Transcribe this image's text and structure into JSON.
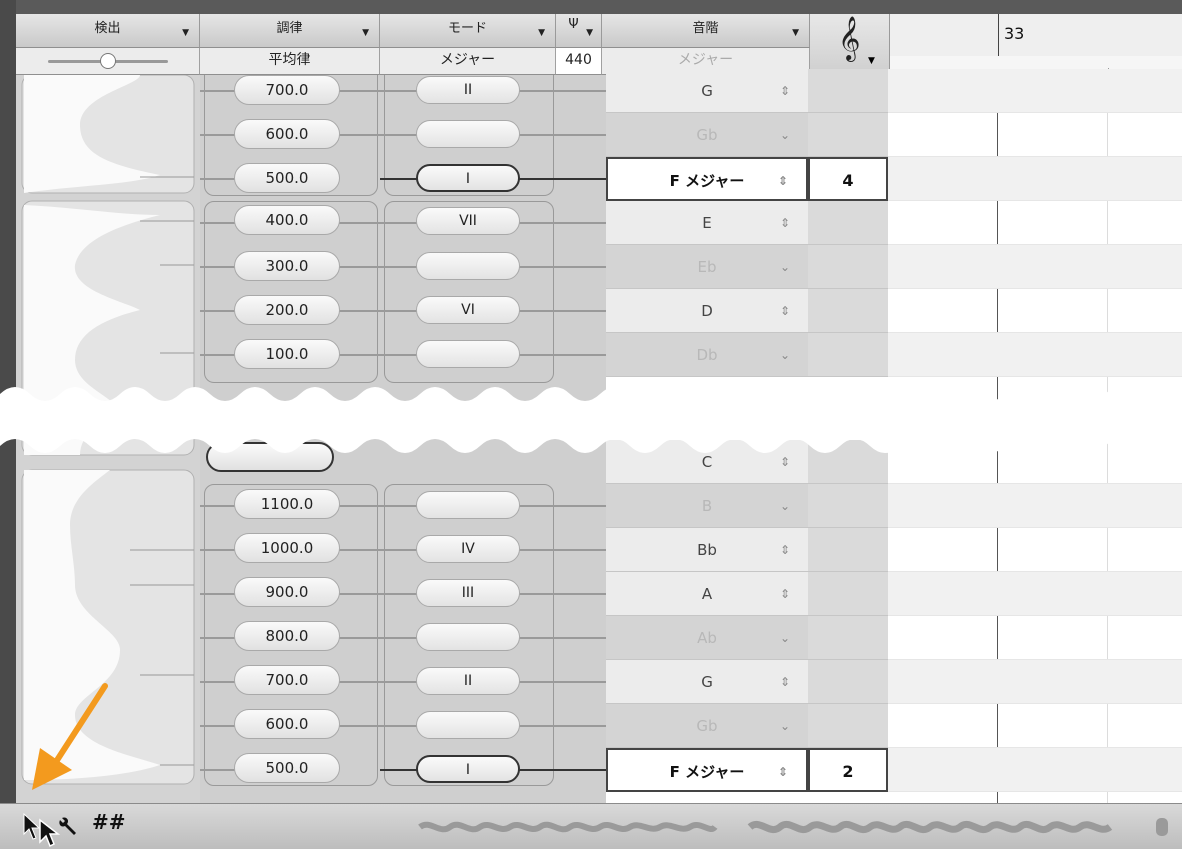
{
  "headers": {
    "detect": "検出",
    "tuning": "調律",
    "mode": "モード",
    "pitch_menu_glyph": "Ψ",
    "scale": "音階"
  },
  "subheaders": {
    "tuning_value": "平均律",
    "mode_value": "メジャー",
    "reference_pitch": "440",
    "scale_value": "メジャー"
  },
  "timeline": {
    "bar_number": "33"
  },
  "top_rows": [
    {
      "cents": "700.0",
      "mode": "II",
      "note": "G",
      "octave": "",
      "kind": "lite",
      "active_mode": true
    },
    {
      "cents": "600.0",
      "mode": "",
      "note": "Gb",
      "octave": "",
      "kind": "dim",
      "active_mode": false
    },
    {
      "cents": "500.0",
      "mode": "I",
      "note": "F メジャー",
      "octave": "4",
      "kind": "sel",
      "active_mode": true
    },
    {
      "cents": "400.0",
      "mode": "VII",
      "note": "E",
      "octave": "",
      "kind": "lite",
      "active_mode": true
    },
    {
      "cents": "300.0",
      "mode": "",
      "note": "Eb",
      "octave": "",
      "kind": "dim",
      "active_mode": false
    },
    {
      "cents": "200.0",
      "mode": "VI",
      "note": "D",
      "octave": "",
      "kind": "lite",
      "active_mode": true
    },
    {
      "cents": "100.0",
      "mode": "",
      "note": "Db",
      "octave": "",
      "kind": "dim",
      "active_mode": false
    }
  ],
  "bottom_rows": [
    {
      "cents": "",
      "mode": "",
      "note": "C",
      "octave": "",
      "kind": "lite",
      "active_mode": false
    },
    {
      "cents": "1100.0",
      "mode": "",
      "note": "B",
      "octave": "",
      "kind": "dim",
      "active_mode": false
    },
    {
      "cents": "1000.0",
      "mode": "IV",
      "note": "Bb",
      "octave": "",
      "kind": "lite",
      "active_mode": true
    },
    {
      "cents": "900.0",
      "mode": "III",
      "note": "A",
      "octave": "",
      "kind": "lite",
      "active_mode": true
    },
    {
      "cents": "800.0",
      "mode": "",
      "note": "Ab",
      "octave": "",
      "kind": "dim",
      "active_mode": false
    },
    {
      "cents": "700.0",
      "mode": "II",
      "note": "G",
      "octave": "",
      "kind": "lite",
      "active_mode": true
    },
    {
      "cents": "600.0",
      "mode": "",
      "note": "Gb",
      "octave": "",
      "kind": "dim",
      "active_mode": false
    },
    {
      "cents": "500.0",
      "mode": "I",
      "note": "F メジャー",
      "octave": "2",
      "kind": "sel",
      "active_mode": true
    }
  ],
  "bottom_toolbar": {
    "icons": [
      "pointer-tool-icon",
      "wrench-icon",
      "sharp-scale-icon"
    ],
    "sharp_glyph": "##"
  },
  "colors": {
    "arrow": "#f39a1e",
    "frame": "#4a4a4a"
  }
}
